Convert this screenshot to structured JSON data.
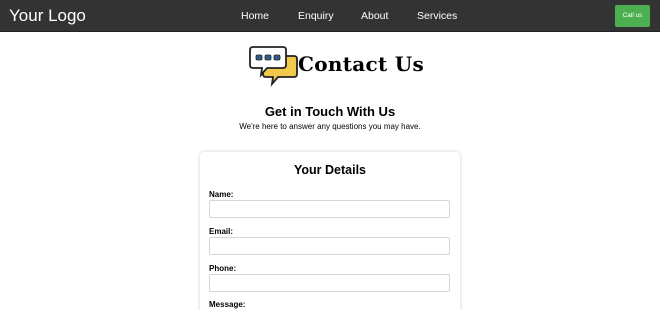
{
  "navbar": {
    "logo": "Your Logo",
    "links": [
      "Home",
      "Enquiry",
      "About",
      "Services"
    ],
    "cta_label": "Call us"
  },
  "hero": {
    "title": "Contact Us",
    "icon": "chat-bubbles-icon"
  },
  "intro": {
    "title": "Get in Touch With Us",
    "subtitle": "We're here to answer any questions you may have."
  },
  "form": {
    "title": "Your Details",
    "fields": [
      {
        "label": "Name:",
        "value": ""
      },
      {
        "label": "Email:",
        "value": ""
      },
      {
        "label": "Phone:",
        "value": ""
      },
      {
        "label": "Message:",
        "value": ""
      }
    ]
  },
  "colors": {
    "navbar_bg": "#333333",
    "cta_bg": "#4caf50",
    "icon_yellow": "#f2c94c"
  }
}
